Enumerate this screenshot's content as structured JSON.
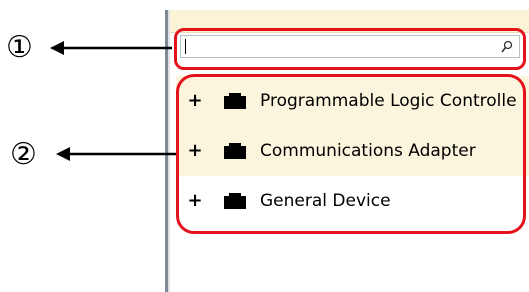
{
  "search": {
    "value": "",
    "icon": "search-icon"
  },
  "tree": {
    "items": [
      {
        "label": "Programmable Logic Controlle",
        "expander": "+",
        "icon": "folder-icon"
      },
      {
        "label": "Communications Adapter",
        "expander": "+",
        "icon": "folder-icon"
      },
      {
        "label": "General Device",
        "expander": "+",
        "icon": "folder-icon"
      }
    ]
  },
  "annotations": {
    "marker_1": "①",
    "marker_2": "②"
  },
  "colors": {
    "callout": "#e3121b",
    "panel_header": "#fbf3d6",
    "row_highlight": "#fcf5dd"
  }
}
